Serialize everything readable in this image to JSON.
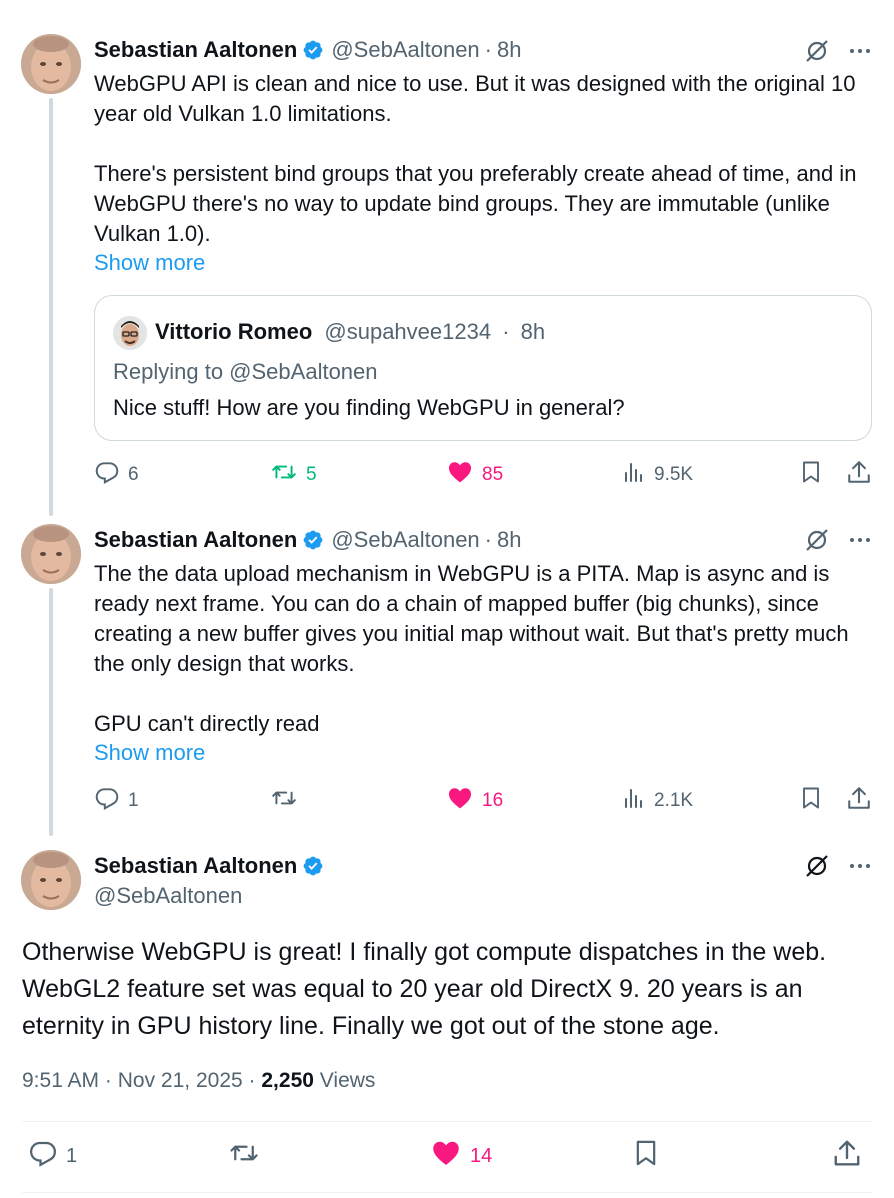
{
  "colors": {
    "accent": "#1d9bf0",
    "retweet": "#00ba7c",
    "like": "#f91880",
    "muted": "#536471"
  },
  "thread": [
    {
      "author": {
        "name": "Sebastian Aaltonen",
        "handle": "@SebAaltonen",
        "time": "8h"
      },
      "body": "WebGPU API is clean and nice to use. But it was designed with the original 10 year old Vulkan 1.0 limitations.\n\nThere's persistent bind groups that you preferably create ahead of time, and in WebGPU there's no way to update bind groups. They are immutable (unlike Vulkan 1.0).",
      "show_more": "Show more",
      "quote": {
        "name": "Vittorio Romeo",
        "handle": "@supahvee1234",
        "time": "8h",
        "replying_to": "Replying to @SebAaltonen",
        "text": "Nice stuff! How are you finding WebGPU in general?"
      },
      "stats": {
        "replies": "6",
        "reposts": "5",
        "likes": "85",
        "views": "9.5K"
      }
    },
    {
      "author": {
        "name": "Sebastian Aaltonen",
        "handle": "@SebAaltonen",
        "time": "8h"
      },
      "body": "The the data upload mechanism in WebGPU is a PITA. Map is async and is ready next frame. You can do a chain of mapped buffer (big chunks), since creating a new buffer gives you initial map without wait. But that's pretty much the only design that works.\n\nGPU can't directly read",
      "show_more": "Show more",
      "stats": {
        "replies": "1",
        "reposts": "",
        "likes": "16",
        "views": "2.1K"
      }
    }
  ],
  "main_post": {
    "author": {
      "name": "Sebastian Aaltonen",
      "handle": "@SebAaltonen"
    },
    "body": "Otherwise WebGPU is great! I finally got compute dispatches in the web. WebGL2 feature set was equal to 20 year old DirectX 9. 20 years is an eternity in GPU history line. Finally we got out of the stone age.",
    "time": "9:51 AM",
    "date": "Nov 21, 2025",
    "views_count": "2,250",
    "views_label": "Views",
    "stats": {
      "replies": "1",
      "likes": "14"
    }
  },
  "separator": "·"
}
